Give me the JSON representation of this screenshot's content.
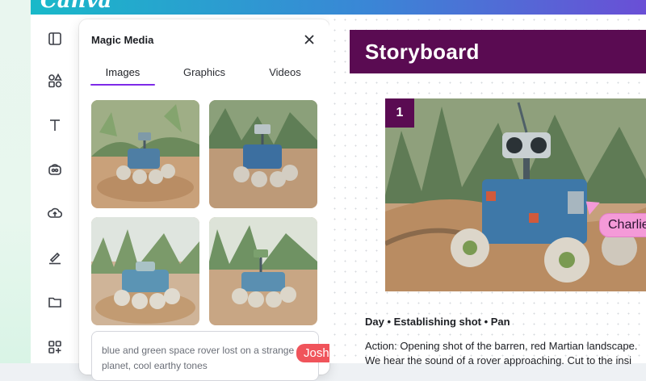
{
  "app": {
    "logo": "Canva"
  },
  "rail": {
    "icons": [
      "layout-icon",
      "elements-icon",
      "text-icon",
      "brand-icon",
      "upload-icon",
      "draw-icon",
      "folder-icon",
      "apps-icon"
    ]
  },
  "panel": {
    "title": "Magic Media",
    "tabs": [
      {
        "label": "Images",
        "active": true
      },
      {
        "label": "Graphics",
        "active": false
      },
      {
        "label": "Videos",
        "active": false
      }
    ],
    "prompt_text": "blue and green space rover lost on a strange planet, cool earthy tones",
    "collaborator": "Josh"
  },
  "storyboard": {
    "title": "Storyboard",
    "frame_number": "1",
    "collaborator": "Charlie",
    "shot_line": "Day • Establishing shot • Pan",
    "action_line_1": "Action: Opening shot of the barren, red Martian landscape.",
    "action_line_2": "We hear the sound of a rover approaching. Cut to the insi"
  },
  "colors": {
    "accent": "#7d2ae8",
    "banner": "#5a0b52",
    "josh": "#f0545b",
    "charlie": "#f49ad8"
  }
}
